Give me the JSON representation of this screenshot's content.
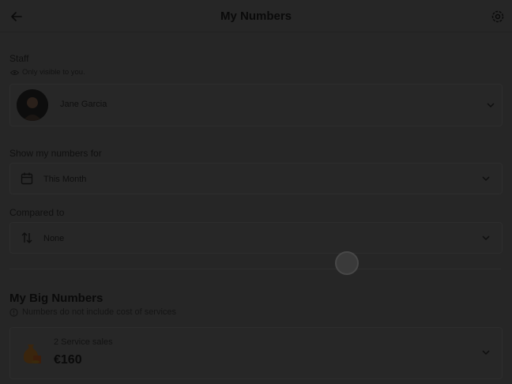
{
  "header": {
    "title": "My Numbers"
  },
  "staff": {
    "label": "Staff",
    "note": "Only visible to you.",
    "selected_name": "Jane Garcia"
  },
  "period": {
    "label": "Show my numbers for",
    "selected": "This Month"
  },
  "compare": {
    "label": "Compared to",
    "selected": "None"
  },
  "big_numbers": {
    "title": "My Big Numbers",
    "note": "Numbers do not include cost of services",
    "items": [
      {
        "subtitle": "2 Service sales",
        "value": "€160"
      }
    ]
  },
  "icons": {
    "back": "arrow-left-icon",
    "settings": "gear-icon",
    "visibility": "eye-icon",
    "calendar": "calendar-icon",
    "compare": "swap-arrows-icon",
    "info": "info-circle-icon",
    "sales": "money-bag-icon",
    "dropdown": "chevron-down-icon"
  },
  "colors": {
    "overlay": "#262626"
  }
}
